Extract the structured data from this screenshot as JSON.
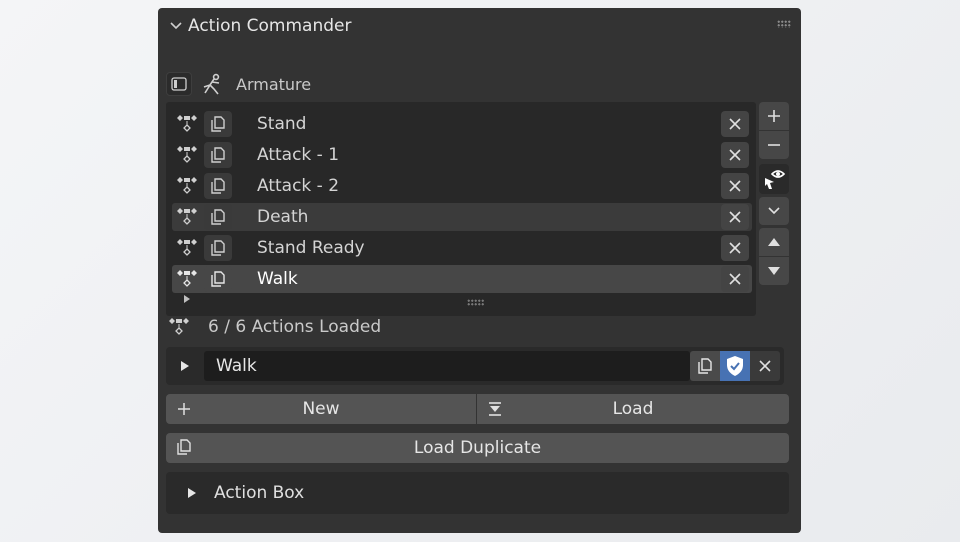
{
  "panel": {
    "title": "Action Commander"
  },
  "object": {
    "name": "Armature"
  },
  "actions": [
    {
      "name": "Stand"
    },
    {
      "name": "Attack - 1"
    },
    {
      "name": "Attack - 2"
    },
    {
      "name": "Death"
    },
    {
      "name": "Stand Ready"
    },
    {
      "name": "Walk"
    }
  ],
  "status": {
    "loaded_text": "6 / 6 Actions Loaded"
  },
  "active_action": {
    "value": "Walk"
  },
  "buttons": {
    "new_label": "New",
    "load_label": "Load",
    "load_duplicate_label": "Load Duplicate"
  },
  "action_box": {
    "label": "Action Box"
  },
  "colors": {
    "panel_bg": "#333333",
    "list_bg": "#282828",
    "button_bg": "#545454",
    "accent_blue": "#4772b3"
  },
  "icons": {
    "collapse": "chevron-down-icon",
    "armature": "armature-icon",
    "object_data": "object-data-icon",
    "keyframe": "keyframe-icon",
    "duplicate": "duplicate-icon",
    "remove": "close-icon",
    "add": "plus-icon",
    "subtract": "minus-icon",
    "visibility": "eye-icon",
    "expand": "chevron-down-icon",
    "move_up": "triangle-up-icon",
    "move_down": "triangle-down-icon",
    "fake_user": "shield-icon",
    "play": "play-icon",
    "load": "import-icon"
  }
}
